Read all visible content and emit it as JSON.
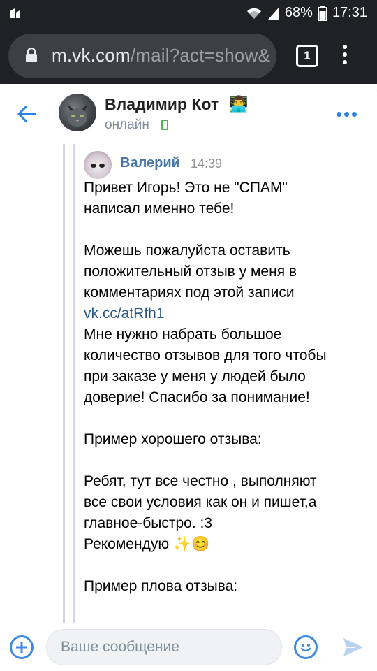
{
  "status_bar": {
    "battery": "68%",
    "time": "17:31"
  },
  "browser": {
    "url_host": "m.vk.com",
    "url_path": "/mail?act=show&",
    "tab_count": "1"
  },
  "conversation": {
    "name": "Владимир Кот",
    "name_emoji": "👨‍💻",
    "status": "онлайн"
  },
  "message": {
    "sender": "Валерий",
    "time": "14:39",
    "lines": [
      "Привет Игорь! Это не \"СПАМ\"",
      "написал именно тебе!",
      "",
      "Можешь пожалуйста оставить",
      "положительный отзыв у меня в",
      "комментариях под этой записи",
      "vk.cc/atRfh1",
      "Мне нужно набрать большое",
      "количество отзывов для того чтобы",
      "при заказе у меня у людей было",
      "доверие! Спасибо за понимание!",
      "",
      "Пример хорошего отзыва:",
      "",
      "Ребят, тут все честно , выполняют",
      "все свои условия как он и пишет,а",
      "главное-быстро. :3",
      "Рекомендую ✨😊",
      "",
      "Пример плова отзыва:"
    ]
  },
  "composer": {
    "placeholder": "Ваше сообщение"
  },
  "colors": {
    "accent": "#2d81e0",
    "link": "#2a5885",
    "online": "#4bb34b",
    "sender_name": "#4a76a8"
  }
}
